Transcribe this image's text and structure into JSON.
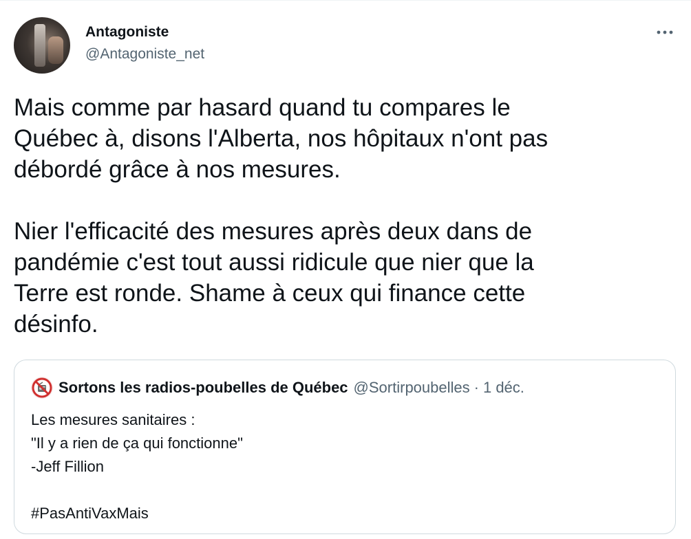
{
  "author": {
    "display_name": "Antagoniste",
    "handle": "@Antagoniste_net",
    "avatar_icon": "profile-photo"
  },
  "more_icon": "more-horizontal-icon",
  "tweet": {
    "paragraphs": [
      "Mais comme par hasard quand tu compares le\nQuébec à, disons l'Alberta, nos hôpitaux n'ont pas\ndébordé grâce à nos mesures.",
      "Nier l'efficacité des mesures après deux dans de\npandémie c'est tout aussi ridicule que nier que la\nTerre est ronde. Shame à ceux qui finance cette\ndésinfo."
    ]
  },
  "quoted": {
    "display_name": "Sortons les radios-poubelles de Québec",
    "handle": "@Sortirpoubelles",
    "separator": "·",
    "date": "1 déc.",
    "avatar_icon": "no-radio-icon",
    "lines": [
      "Les mesures sanitaires :",
      "\"Il y a rien de ça qui fonctionne\"",
      "-Jeff Fillion",
      "",
      "#PasAntiVaxMais"
    ]
  },
  "colors": {
    "text": "#0f1419",
    "secondary": "#536471",
    "border": "#cfd9de",
    "no_sign_red": "#d0302f"
  }
}
